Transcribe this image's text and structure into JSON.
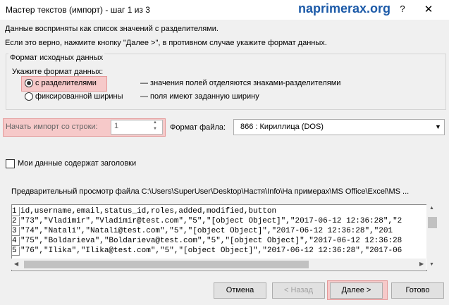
{
  "window": {
    "title": "Мастер текстов (импорт) - шаг 1 из 3",
    "watermark": "naprimerax.org",
    "help": "?",
    "close": "✕"
  },
  "intro": {
    "line1": "Данные восприняты как список значений с разделителями.",
    "line2": "Если это верно, нажмите кнопку \"Далее >\", в противном случае укажите формат данных."
  },
  "source_group": {
    "title": "Формат исходных данных",
    "subtitle": "Укажите формат данных:",
    "options": [
      {
        "label": "с разделителями",
        "description": "— значения полей отделяются знаками-разделителями",
        "selected": true
      },
      {
        "label": "фиксированной ширины",
        "description": "— поля имеют заданную ширину",
        "selected": false
      }
    ]
  },
  "start_row": {
    "label": "Начать импорт со строки:",
    "value": "1"
  },
  "file_format": {
    "label": "Формат файла:",
    "value": "866 : Кириллица (DOS)"
  },
  "headers_checkbox": {
    "label": "Мои данные содержат заголовки",
    "checked": false
  },
  "preview": {
    "label": "Предварительный просмотр файла C:\\Users\\SuperUser\\Desktop\\Настя\\Info\\На примерах\\MS Office\\Excel\\MS ...",
    "rows": [
      {
        "num": "1",
        "text": "id,username,email,status_id,roles,added,modified,button"
      },
      {
        "num": "2",
        "text": "\"73\",\"Vladimir\",\"Vladimir@test.com\",\"5\",\"[object Object]\",\"2017-06-12 12:36:28\",\"2"
      },
      {
        "num": "3",
        "text": "\"74\",\"Natali\",\"Natali@test.com\",\"5\",\"[object Object]\",\"2017-06-12 12:36:28\",\"201"
      },
      {
        "num": "4",
        "text": "\"75\",\"Boldarieva\",\"Boldarieva@test.com\",\"5\",\"[object Object]\",\"2017-06-12 12:36:28"
      },
      {
        "num": "5",
        "text": "\"76\",\"Ilika\",\"Ilika@test.com\",\"5\",\"[object Object]\",\"2017-06-12 12:36:28\",\"2017-06"
      }
    ]
  },
  "buttons": {
    "cancel": "Отмена",
    "back": "< Назад",
    "next": "Далее >",
    "done": "Готово"
  },
  "colors": {
    "highlight": "#f6c9c9",
    "watermark": "#1c5aa8",
    "background": "#f0f0f0"
  }
}
